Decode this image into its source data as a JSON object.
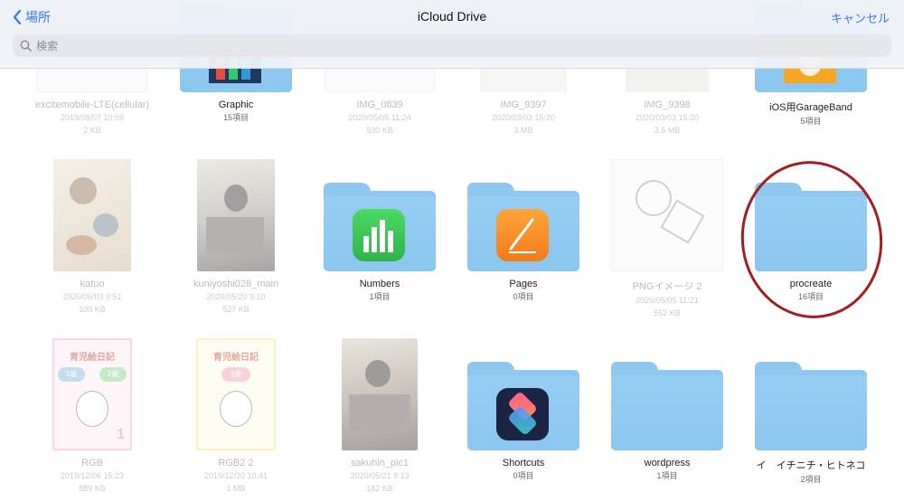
{
  "nav": {
    "back_label": "場所",
    "title": "iCloud Drive",
    "cancel_label": "キャンセル"
  },
  "search": {
    "placeholder": "検索"
  },
  "row1": [
    {
      "name": "excitemobile-LTE(cellular)",
      "date": "2019/08/07 10:59",
      "size": "2 KB",
      "kind": "file",
      "faded": true
    },
    {
      "name": "Graphic",
      "count": "15項目",
      "kind": "folder",
      "faded": false
    },
    {
      "name": "IMG_0839",
      "date": "2020/05/05 11:24",
      "size": "530 KB",
      "kind": "file",
      "faded": true
    },
    {
      "name": "IMG_9397",
      "date": "2020/03/03 15:20",
      "size": "3 MB",
      "kind": "file",
      "faded": true
    },
    {
      "name": "IMG_9398",
      "date": "2020/03/03 15:20",
      "size": "3.6 MB",
      "kind": "file",
      "faded": true
    },
    {
      "name": "iOS用GarageBand",
      "count": "5項目",
      "kind": "folder",
      "faded": false
    }
  ],
  "row2": [
    {
      "name": "katuo",
      "date": "2020/06/03 9:51",
      "size": "100 KB",
      "kind": "image",
      "faded": true
    },
    {
      "name": "kuniyoshi028_main",
      "date": "2020/05/20 9:10",
      "size": "527 KB",
      "kind": "image",
      "faded": true
    },
    {
      "name": "Numbers",
      "count": "1項目",
      "kind": "folder",
      "icon": "numbers-app-icon",
      "faded": false
    },
    {
      "name": "Pages",
      "count": "0項目",
      "kind": "folder",
      "icon": "pages-app-icon",
      "faded": false
    },
    {
      "name": "PNGイメージ 2",
      "date": "2020/05/05 11:21",
      "size": "552 KB",
      "kind": "image",
      "faded": true
    },
    {
      "name": "procreate",
      "count": "16項目",
      "kind": "folder",
      "faded": false
    }
  ],
  "row3": [
    {
      "name": "RGB",
      "date": "2019/12/06 15:23",
      "size": "889 KB",
      "kind": "image",
      "faded": true
    },
    {
      "name": "RGB2 2",
      "date": "2019/12/20 10:41",
      "size": "1 MB",
      "kind": "image",
      "faded": true
    },
    {
      "name": "sakuhin_pic1",
      "date": "2020/05/21 9:13",
      "size": "182 KB",
      "kind": "image",
      "faded": true
    },
    {
      "name": "Shortcuts",
      "count": "0項目",
      "kind": "folder",
      "icon": "shortcuts-app-icon",
      "faded": false
    },
    {
      "name": "wordpress",
      "count": "1項目",
      "kind": "folder",
      "faded": false
    },
    {
      "name": "イ　イチニチ・ヒトネコ",
      "count": "2項目",
      "kind": "folder",
      "faded": false
    }
  ],
  "thumb_text": {
    "diary_title": "育児絵日記",
    "age1": "1歳",
    "age2": "2歳",
    "age3": "3歳",
    "corner_num": "1"
  },
  "colors": {
    "accent": "#3478f6",
    "folder": "#8ec8f0",
    "annotation_ring": "#a51d1d"
  }
}
